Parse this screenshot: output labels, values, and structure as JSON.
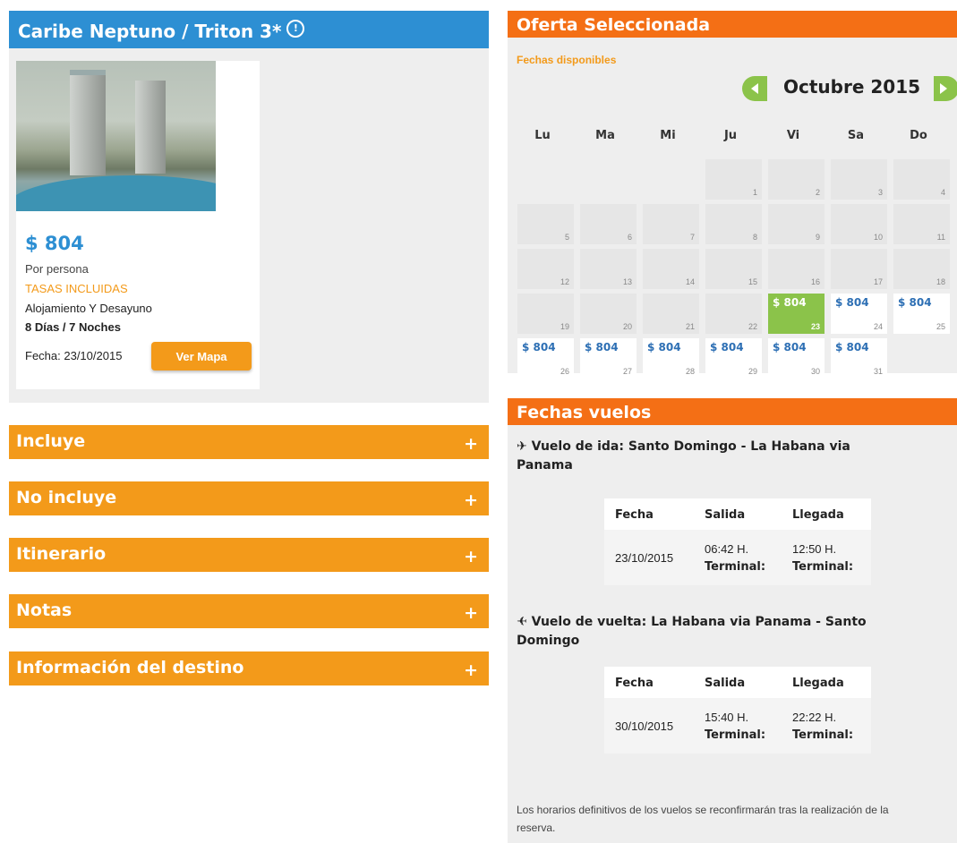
{
  "hotel": {
    "title": "Caribe Neptuno / Triton 3*",
    "info_icon": "info-circle-icon",
    "price": "$ 804",
    "per_person": "Por persona",
    "taxes": "TASAS INCLUIDAS",
    "board": "Alojamiento Y Desayuno",
    "duration": "8 Días / 7 Noches",
    "date": "Fecha: 23/10/2015",
    "map_button": "Ver Mapa"
  },
  "accordion": [
    {
      "label": "Incluye",
      "icon": "+"
    },
    {
      "label": "No incluye",
      "icon": "+"
    },
    {
      "label": "Itinerario",
      "icon": "+"
    },
    {
      "label": "Notas",
      "icon": "+"
    },
    {
      "label": "Información del destino",
      "icon": "+"
    }
  ],
  "calendar": {
    "header": "Oferta Seleccionada",
    "available_label": "Fechas disponibles",
    "month": "Octubre 2015",
    "weekdays": [
      "Lu",
      "Ma",
      "Mi",
      "Ju",
      "Vi",
      "Sa",
      "Do"
    ],
    "days": [
      {
        "d": "1"
      },
      {
        "d": "2"
      },
      {
        "d": "3"
      },
      {
        "d": "4"
      },
      {
        "d": "5"
      },
      {
        "d": "6"
      },
      {
        "d": "7"
      },
      {
        "d": "8"
      },
      {
        "d": "9"
      },
      {
        "d": "10"
      },
      {
        "d": "11"
      },
      {
        "d": "12"
      },
      {
        "d": "13"
      },
      {
        "d": "14"
      },
      {
        "d": "15"
      },
      {
        "d": "16"
      },
      {
        "d": "17"
      },
      {
        "d": "18"
      },
      {
        "d": "19"
      },
      {
        "d": "20"
      },
      {
        "d": "21"
      },
      {
        "d": "22"
      },
      {
        "d": "23",
        "price": "$ 804",
        "selected": true
      },
      {
        "d": "24",
        "price": "$ 804"
      },
      {
        "d": "25",
        "price": "$ 804"
      },
      {
        "d": "26",
        "price": "$ 804"
      },
      {
        "d": "27",
        "price": "$ 804"
      },
      {
        "d": "28",
        "price": "$ 804"
      },
      {
        "d": "29",
        "price": "$ 804"
      },
      {
        "d": "30",
        "price": "$ 804"
      },
      {
        "d": "31",
        "price": "$ 804"
      }
    ],
    "colors": {
      "header": "#f46f15",
      "selected": "#8bc34a",
      "price": "#2d6fb4"
    }
  },
  "flights": {
    "header": "Fechas vuelos",
    "outbound": {
      "title": "Vuelo de ida: Santo Domingo - La Habana via Panama",
      "icon": "plane-right-icon",
      "col_fecha": "Fecha",
      "col_salida": "Salida",
      "col_llegada": "Llegada",
      "fecha": "23/10/2015",
      "salida": "06:42 H.",
      "llegada": "12:50 H.",
      "terminal": "Terminal:"
    },
    "return": {
      "title": "Vuelo de vuelta: La Habana via Panama - Santo Domingo",
      "icon": "plane-left-icon",
      "col_fecha": "Fecha",
      "col_salida": "Salida",
      "col_llegada": "Llegada",
      "fecha": "30/10/2015",
      "salida": "15:40 H.",
      "llegada": "22:22 H.",
      "terminal": "Terminal:"
    },
    "note": "Los horarios definitivos de los vuelos se reconfirmarán tras la realización de la reserva."
  }
}
